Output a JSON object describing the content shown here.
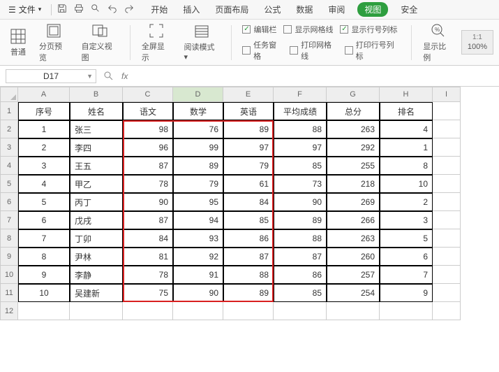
{
  "topbar": {
    "file": "文件",
    "tabs": [
      "开始",
      "插入",
      "页面布局",
      "公式",
      "数据",
      "审阅",
      "视图",
      "安全"
    ],
    "active": 6
  },
  "ribbon": {
    "groups": [
      {
        "label": "普通"
      },
      {
        "label": "分页预览"
      },
      {
        "label": "自定义视图"
      },
      {
        "label": "全屏显示"
      },
      {
        "label": "阅读模式"
      }
    ],
    "checks": {
      "row1": [
        {
          "label": "编辑栏",
          "checked": true
        },
        {
          "label": "显示网格线",
          "checked": false
        },
        {
          "label": "显示行号列标",
          "checked": true
        }
      ],
      "row2": [
        {
          "label": "任务窗格",
          "checked": false
        },
        {
          "label": "打印网格线",
          "checked": false
        },
        {
          "label": "打印行号列标",
          "checked": false
        }
      ]
    },
    "zoom": {
      "ratio": "显示比例",
      "pct": "100%"
    }
  },
  "formula": {
    "cellref": "D17"
  },
  "columns": [
    "A",
    "B",
    "C",
    "D",
    "E",
    "F",
    "G",
    "H",
    "I"
  ],
  "headers": [
    "序号",
    "姓名",
    "语文",
    "数学",
    "英语",
    "平均成绩",
    "总分",
    "排名"
  ],
  "rows": [
    {
      "n": "1",
      "nm": "张三",
      "c": 98,
      "d": 76,
      "e": 89,
      "f": 88,
      "g": 263,
      "h": 4
    },
    {
      "n": "2",
      "nm": "李四",
      "c": 96,
      "d": 99,
      "e": 97,
      "f": 97,
      "g": 292,
      "h": 1
    },
    {
      "n": "3",
      "nm": "王五",
      "c": 87,
      "d": 89,
      "e": 79,
      "f": 85,
      "g": 255,
      "h": 8
    },
    {
      "n": "4",
      "nm": "甲乙",
      "c": 78,
      "d": 79,
      "e": 61,
      "f": 73,
      "g": 218,
      "h": 10
    },
    {
      "n": "5",
      "nm": "丙丁",
      "c": 90,
      "d": 95,
      "e": 84,
      "f": 90,
      "g": 269,
      "h": 2
    },
    {
      "n": "6",
      "nm": "戊戌",
      "c": 87,
      "d": 94,
      "e": 85,
      "f": 89,
      "g": 266,
      "h": 3
    },
    {
      "n": "7",
      "nm": "丁卯",
      "c": 84,
      "d": 93,
      "e": 86,
      "f": 88,
      "g": 263,
      "h": 5
    },
    {
      "n": "8",
      "nm": "尹林",
      "c": 81,
      "d": 92,
      "e": 87,
      "f": 87,
      "g": 260,
      "h": 6
    },
    {
      "n": "9",
      "nm": "李静",
      "c": 78,
      "d": 91,
      "e": 88,
      "f": 86,
      "g": 257,
      "h": 7
    },
    {
      "n": "10",
      "nm": "吴建新",
      "c": 75,
      "d": 90,
      "e": 89,
      "f": 85,
      "g": 254,
      "h": 9
    }
  ]
}
